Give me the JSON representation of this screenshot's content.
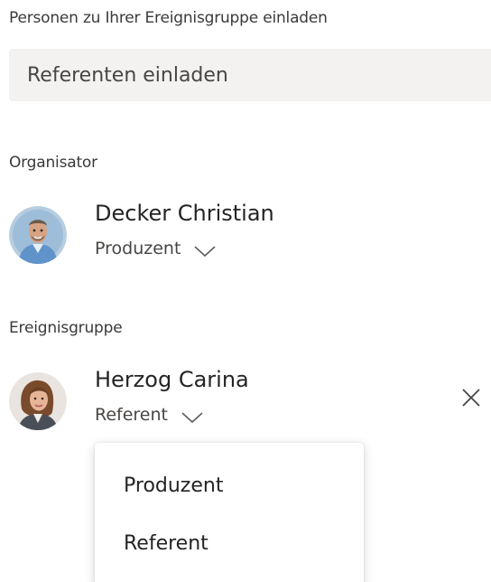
{
  "invite": {
    "label": "Personen zu Ihrer Ereignisgruppe einladen",
    "placeholder": "Referenten einladen"
  },
  "organizer": {
    "section_label": "Organisator",
    "name": "Decker Christian",
    "role": "Produzent"
  },
  "event_group": {
    "section_label": "Ereignisgruppe",
    "members": [
      {
        "name": "Herzog Carina",
        "role": "Referent"
      }
    ]
  },
  "role_dropdown": {
    "options": [
      "Produzent",
      "Referent"
    ]
  }
}
